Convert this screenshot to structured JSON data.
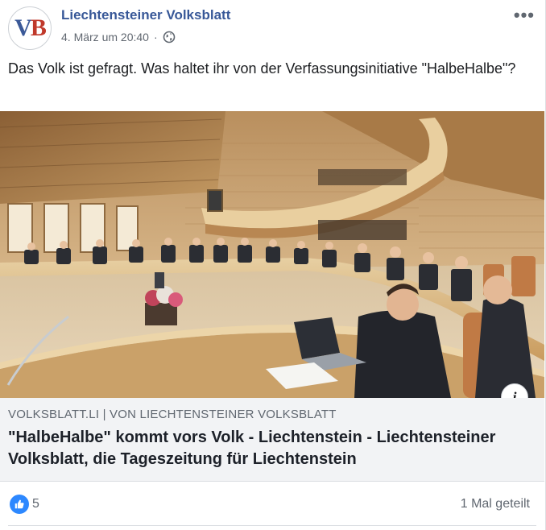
{
  "header": {
    "page_name": "Liechtensteiner Volksblatt",
    "timestamp": "4. März um 20:40",
    "avatar_text_v": "V",
    "avatar_text_b": "B",
    "privacy_icon": "globe-icon",
    "more_icon": "more-options-icon"
  },
  "post": {
    "text": "Das Volk ist gefragt. Was haltet ihr von der Verfassungsinitiative \"HalbeHalbe\"?"
  },
  "link_preview": {
    "domain": "VOLKSBLATT.LI | VON LIECHTENSTEINER VOLKSBLATT",
    "title": "\"HalbeHalbe\" kommt vors Volk - Liechtenstein - Liechtensteiner Volksblatt, die Tageszeitung für Liechtenstein",
    "info_icon": "i"
  },
  "footer": {
    "like_count": "5",
    "share_count": "1 Mal geteilt"
  },
  "colors": {
    "link_blue": "#385898",
    "like_blue": "#2d88ff",
    "meta_gray": "#606770",
    "preview_bg": "#f2f3f5"
  }
}
